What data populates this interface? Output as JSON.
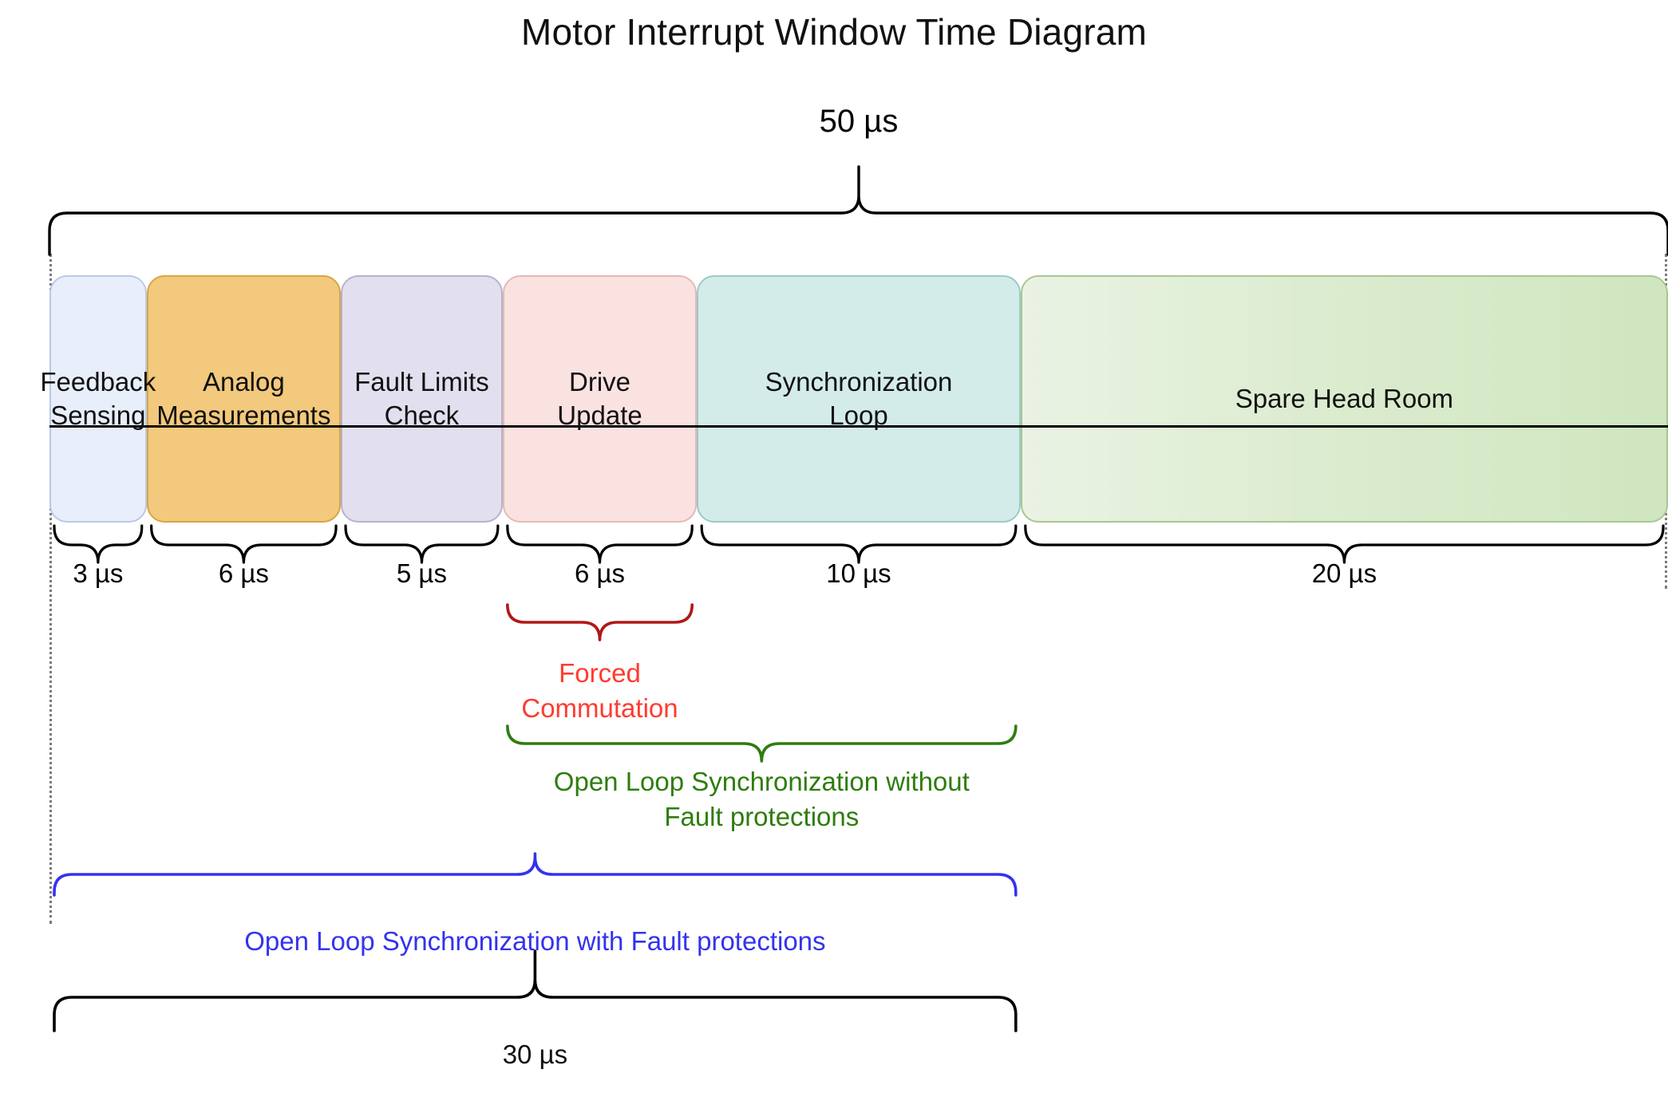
{
  "diagram": {
    "title": "Motor Interrupt Window Time Diagram",
    "total_label": "50 µs",
    "bottom_total_label": "30 µs"
  },
  "chart_data": {
    "type": "timeline",
    "title": "Motor Interrupt Window Time Diagram",
    "unit": "µs",
    "total_window": 50,
    "total_window_label": "50 µs",
    "highlighted_subtotal": 30,
    "highlighted_subtotal_label": "30 µs",
    "xlabel": "",
    "ylabel": "",
    "segments": [
      {
        "name": "Feedback Sensing",
        "label": "Feedback\nSensing",
        "duration": 3,
        "duration_label": "3 µs",
        "start": 0,
        "end": 3,
        "color": "#e8effa",
        "border": "#b9c9e8"
      },
      {
        "name": "Analog Measurements",
        "label": "Analog\nMeasurements",
        "duration": 6,
        "duration_label": "6 µs",
        "start": 3,
        "end": 9,
        "color": "#f2c97d",
        "border": "#d9a542"
      },
      {
        "name": "Fault Limits Check",
        "label": "Fault Limits\nCheck",
        "duration": 5,
        "duration_label": "5 µs",
        "start": 9,
        "end": 14,
        "color": "#e2e0ee",
        "border": "#b6b2d0"
      },
      {
        "name": "Drive Update",
        "label": "Drive\nUpdate",
        "duration": 6,
        "duration_label": "6 µs",
        "start": 14,
        "end": 20,
        "color": "#fae2e1",
        "border": "#e5b9b6"
      },
      {
        "name": "Synchronization Loop",
        "label": "Synchronization\nLoop",
        "duration": 10,
        "duration_label": "10 µs",
        "start": 20,
        "end": 30,
        "color": "#d3ecea",
        "border": "#9ccac6"
      },
      {
        "name": "Spare Head Room",
        "label": "Spare Head Room",
        "duration": 20,
        "duration_label": "20 µs",
        "start": 30,
        "end": 50,
        "color": "#dcecd0",
        "border": "#a8c792"
      }
    ],
    "annotations": [
      {
        "id": "forced-commutation",
        "text": "Forced\nCommutation",
        "text_line1": "Forced",
        "text_line2": "Commutation",
        "start": 14,
        "end": 20,
        "span_label": "",
        "text_color": "#ff3b30",
        "brace_color": "#b01818"
      },
      {
        "id": "open-loop-without-fault",
        "text": "Open Loop Synchronization without\nFault protections",
        "text_line1": "Open Loop Synchronization without",
        "text_line2": "Fault protections",
        "start": 14,
        "end": 30,
        "span_label": "",
        "text_color": "#2e7d0e",
        "brace_color": "#2e7d0e"
      },
      {
        "id": "open-loop-with-fault",
        "text": "Open Loop Synchronization with Fault protections",
        "text_line1": "Open Loop Synchronization with Fault protections",
        "text_line2": "",
        "start": 0,
        "end": 30,
        "span_label": "",
        "text_color": "#3333ee",
        "brace_color": "#3333ee"
      },
      {
        "id": "bottom-total",
        "text": "30 µs",
        "text_line1": "30 µs",
        "text_line2": "",
        "start": 0,
        "end": 30,
        "span_label": "30 µs",
        "text_color": "#111111",
        "brace_color": "#000000"
      },
      {
        "id": "top-total",
        "text": "50 µs",
        "text_line1": "50 µs",
        "text_line2": "",
        "start": 0,
        "end": 50,
        "span_label": "50 µs",
        "text_color": "#111111",
        "brace_color": "#000000"
      }
    ],
    "colors": {
      "red": "#ff3b30",
      "dark_red": "#b01818",
      "green": "#2e7d0e",
      "blue": "#3333ee",
      "black": "#000000",
      "guide": "#7a7a7a"
    }
  }
}
